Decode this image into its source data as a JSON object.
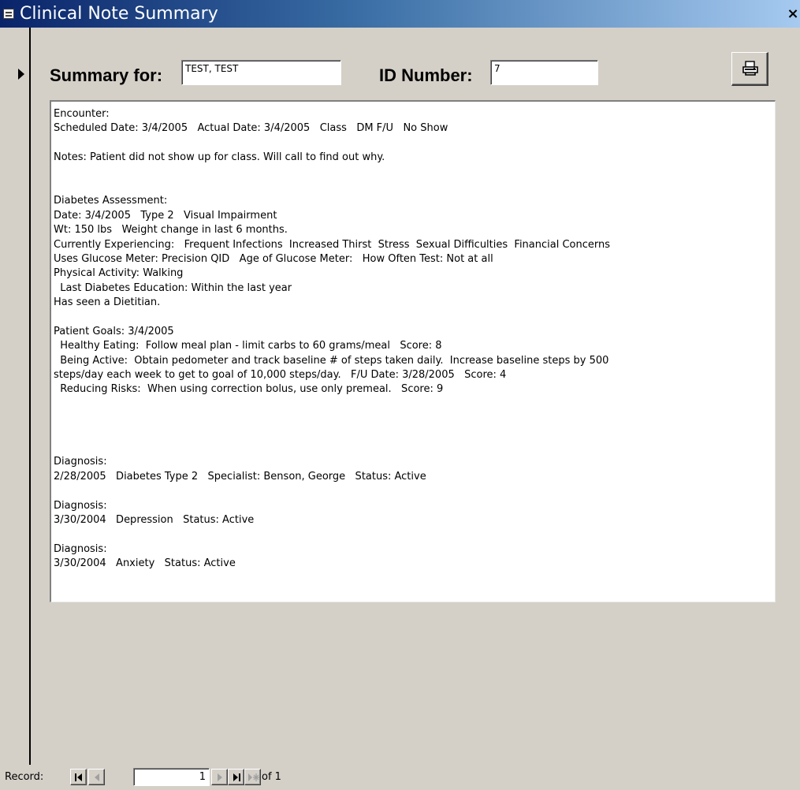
{
  "window": {
    "title": "Clinical Note Summary",
    "close_label": "×"
  },
  "header": {
    "summary_label": "Summary for:",
    "summary_value": "TEST, TEST",
    "id_label": "ID Number:",
    "id_value": "7",
    "print_icon": "printer-icon"
  },
  "memo": {
    "lines": [
      "Encounter:",
      "Scheduled Date: 3/4/2005   Actual Date: 3/4/2005   Class   DM F/U   No Show",
      "",
      "Notes: Patient did not show up for class. Will call to find out why.",
      "",
      "",
      "Diabetes Assessment:",
      "Date: 3/4/2005   Type 2   Visual Impairment",
      "Wt: 150 lbs   Weight change in last 6 months.",
      "Currently Experiencing:   Frequent Infections  Increased Thirst  Stress  Sexual Difficulties  Financial Concerns",
      "Uses Glucose Meter: Precision QID   Age of Glucose Meter:   How Often Test: Not at all",
      "Physical Activity: Walking",
      "  Last Diabetes Education: Within the last year",
      "Has seen a Dietitian.",
      "",
      "Patient Goals: 3/4/2005",
      "  Healthy Eating:  Follow meal plan - limit carbs to 60 grams/meal   Score: 8",
      "  Being Active:  Obtain pedometer and track baseline # of steps taken daily.  Increase baseline steps by 500",
      "steps/day each week to get to goal of 10,000 steps/day.   F/U Date: 3/28/2005   Score: 4",
      "  Reducing Risks:  When using correction bolus, use only premeal.   Score: 9",
      "",
      "",
      "",
      "",
      "Diagnosis:",
      "2/28/2005   Diabetes Type 2   Specialist: Benson, George   Status: Active",
      "",
      "Diagnosis:",
      "3/30/2004   Depression   Status: Active",
      "",
      "Diagnosis:",
      "3/30/2004   Anxiety   Status: Active"
    ]
  },
  "navigation": {
    "record_label": "Record:",
    "current_record": "1",
    "of_label": "of 1",
    "buttons": [
      "first-record-icon",
      "previous-record-icon",
      "next-record-icon",
      "last-record-icon",
      "new-record-icon"
    ]
  }
}
